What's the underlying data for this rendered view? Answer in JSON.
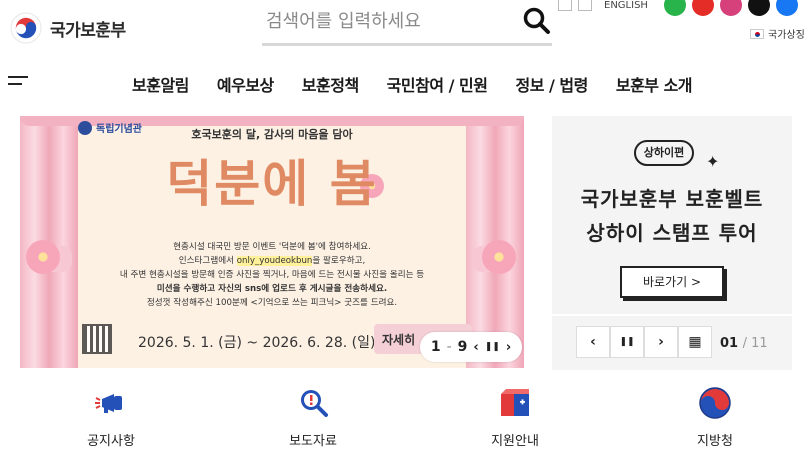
{
  "header": {
    "logo_text": "국가보훈부",
    "search_placeholder": "검색어를 입력하세요",
    "english_label": "ENGLISH",
    "gov_sign": "국가상징"
  },
  "gnb": [
    {
      "label": "보훈알림"
    },
    {
      "label": "예우보상"
    },
    {
      "label": "보훈정책"
    },
    {
      "label": "국민참여 / 민원"
    },
    {
      "label": "정보 / 법령"
    },
    {
      "label": "보훈부 소개"
    }
  ],
  "banner": {
    "museum": "독립기념관",
    "subtitle": "호국보훈의 달, 감사의 마음을 담아",
    "title": "덕분에 봄",
    "line1": "현충시설 대국민 방문 이벤트 '덕분에 봄'에 참여하세요.",
    "line2_a": "인스타그램에서 ",
    "line2_hl": "only_youdeokbun",
    "line2_b": "을 팔로우하고,",
    "line3": "내 주변 현충시설을 방문해 인증 사진을 찍거나, 마음에 드는 전시물 사진을 올리는 등",
    "line4": "미션을 수행하고 자신의 sns에 업로드 후 게시글을 전송하세요.",
    "line5": "정성껏 작성해주신 100분께 <기억으로 쓰는 피크닉> 굿즈를 드려요.",
    "date": "2026. 5. 1. (금) ~ 2026. 6. 28. (일)",
    "detail_label": "자세히",
    "current": "1",
    "sep": "-",
    "total": "9",
    "prev": "‹",
    "pause": "❚❚",
    "next": "›"
  },
  "side": {
    "badge": "상하이편",
    "title_line1": "국가보훈부 보훈벨트",
    "title_line2": "상하이 스탬프 투어",
    "go_label": "바로가기 >",
    "prev": "‹",
    "pause": "❚❚",
    "next": "›",
    "grid": "▦",
    "current": "01",
    "total": "/ 11"
  },
  "quick_links": [
    {
      "label": "공지사항",
      "icon": "megaphone-icon"
    },
    {
      "label": "보도자료",
      "icon": "magnifier-alert-icon"
    },
    {
      "label": "지원안내",
      "icon": "support-box-icon"
    },
    {
      "label": "지방청",
      "icon": "taegeuk-icon"
    }
  ],
  "colors": {
    "accent_red": "#e23a3a",
    "accent_blue": "#2451b7",
    "banner_bg": "#fdf1e4",
    "title_orange": "#e08a63"
  }
}
